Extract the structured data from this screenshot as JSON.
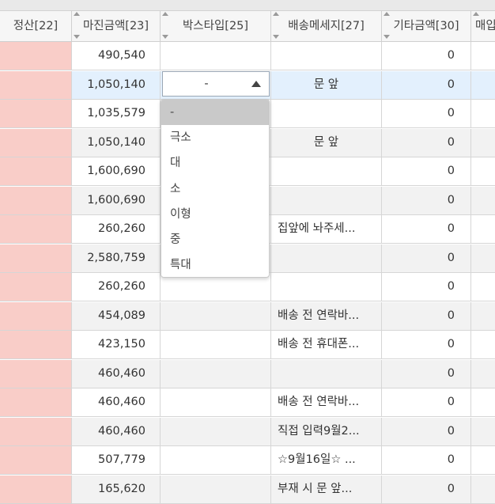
{
  "headers": [
    {
      "label": "정산[22]"
    },
    {
      "label": "마진금액[23]"
    },
    {
      "label": "박스타입[25]"
    },
    {
      "label": "배송메세지[27]"
    },
    {
      "label": "기타금액[30]"
    },
    {
      "label": "매입"
    }
  ],
  "rows": [
    {
      "margin": "490,540",
      "box": "",
      "msg": "",
      "etc": "0"
    },
    {
      "margin": "1,050,140",
      "box": "",
      "msg": "문 앞",
      "etc": "0"
    },
    {
      "margin": "1,035,579",
      "box": "",
      "msg": "",
      "etc": "0"
    },
    {
      "margin": "1,050,140",
      "box": "",
      "msg": "문 앞",
      "etc": "0"
    },
    {
      "margin": "1,600,690",
      "box": "",
      "msg": "",
      "etc": "0"
    },
    {
      "margin": "1,600,690",
      "box": "",
      "msg": "",
      "etc": "0"
    },
    {
      "margin": "260,260",
      "box": "",
      "msg": "집앞에 놔주세...",
      "etc": "0"
    },
    {
      "margin": "2,580,759",
      "box": "",
      "msg": "",
      "etc": "0"
    },
    {
      "margin": "260,260",
      "box": "",
      "msg": "",
      "etc": "0"
    },
    {
      "margin": "454,089",
      "box": "",
      "msg": "배송 전 연락바...",
      "etc": "0"
    },
    {
      "margin": "423,150",
      "box": "",
      "msg": "배송 전 휴대폰...",
      "etc": "0"
    },
    {
      "margin": "460,460",
      "box": "",
      "msg": "",
      "etc": "0"
    },
    {
      "margin": "460,460",
      "box": "",
      "msg": "배송 전 연락바...",
      "etc": "0"
    },
    {
      "margin": "460,460",
      "box": "",
      "msg": "직접 입력9월2...",
      "etc": "0"
    },
    {
      "margin": "507,779",
      "box": "",
      "msg": "☆9월16일☆ ...",
      "etc": "0"
    },
    {
      "margin": "165,620",
      "box": "",
      "msg": "부재 시 문 앞...",
      "etc": "0"
    }
  ],
  "box_type_select": {
    "selected_value": "-",
    "options": [
      "-",
      "극소",
      "대",
      "소",
      "이형",
      "중",
      "특대"
    ]
  },
  "colors": {
    "settle_column": "#f9cdc8",
    "selected_row": "#e3f0fd",
    "active_option": "#c9c9c9"
  }
}
